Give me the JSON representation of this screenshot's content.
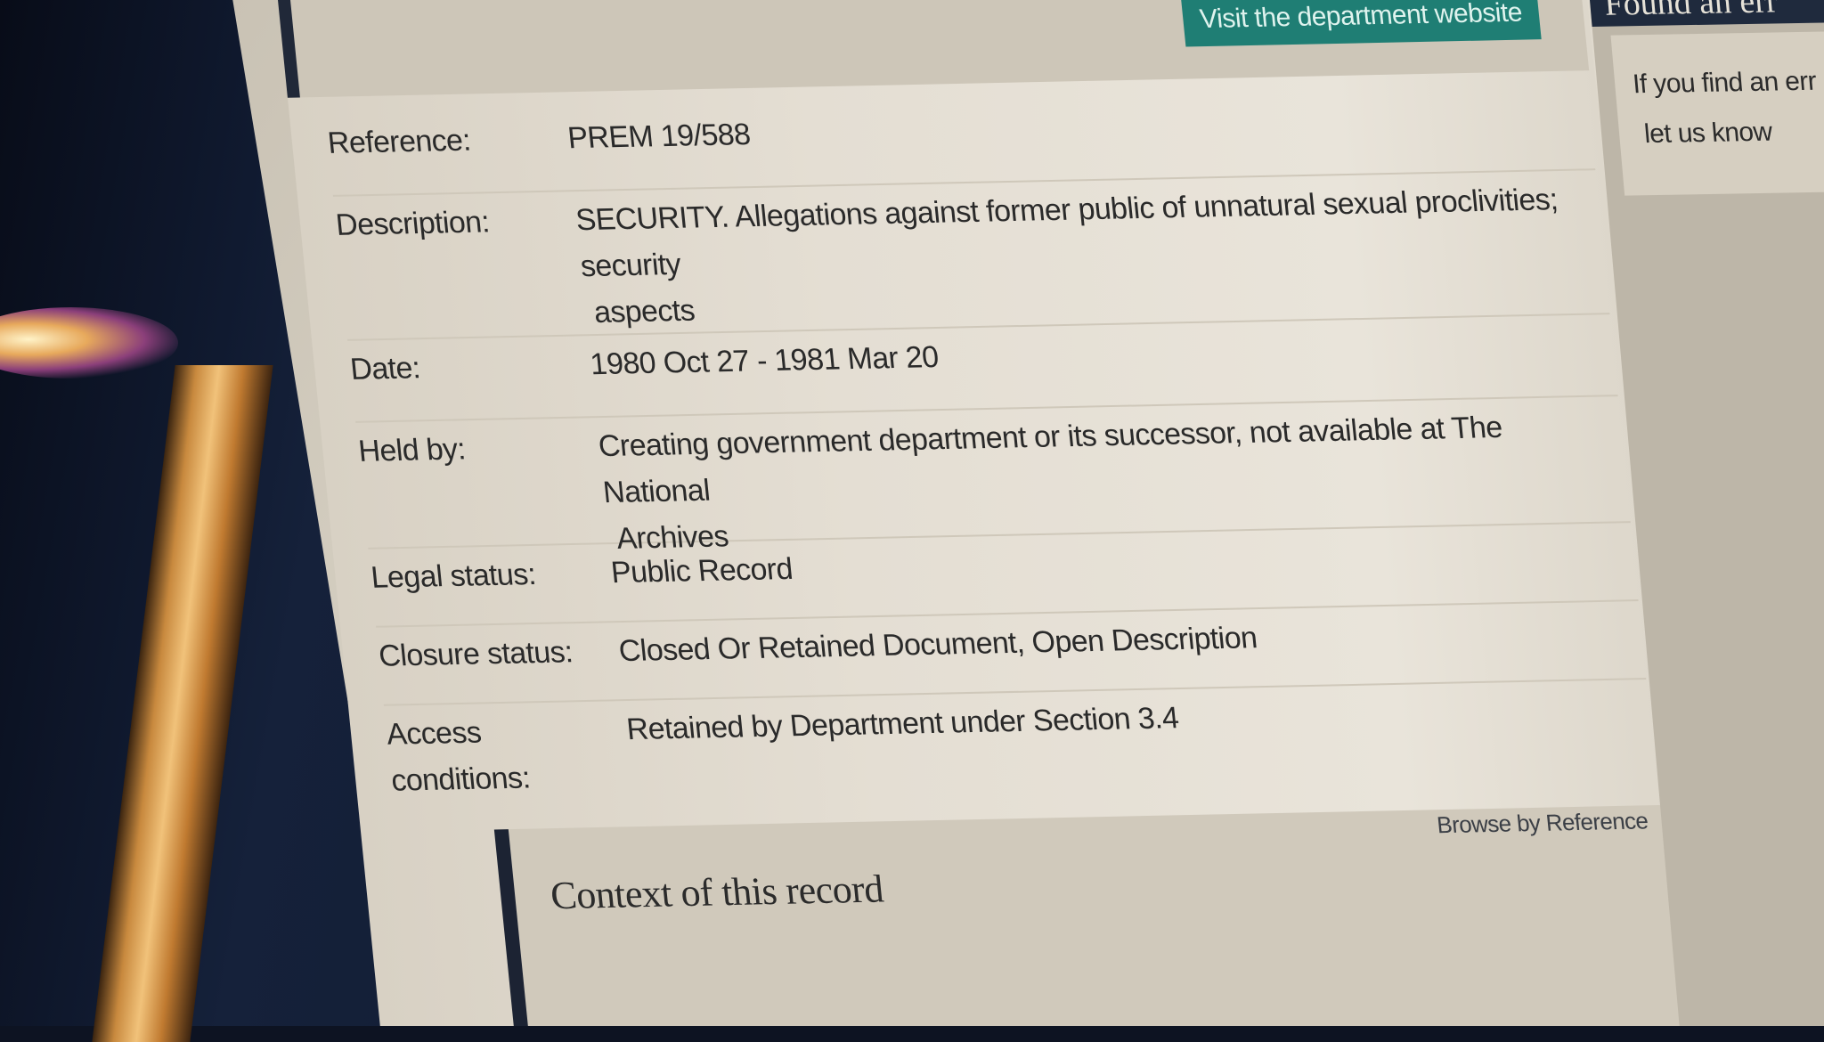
{
  "header": {
    "department_button": "Visit the department website"
  },
  "record": {
    "reference_label": "Reference:",
    "reference_value": "PREM 19/588",
    "description_label": "Description:",
    "description_value_line1": "SECURITY. Allegations against former public of unnatural sexual proclivities; security",
    "description_value_line2": "aspects",
    "date_label": "Date:",
    "date_value": "1980 Oct 27 - 1981 Mar 20",
    "held_by_label": "Held by:",
    "held_by_value_line1": "Creating government department or its successor, not available at The National",
    "held_by_value_line2": "Archives",
    "legal_status_label": "Legal status:",
    "legal_status_value": "Public Record",
    "closure_status_label": "Closure status:",
    "closure_status_value": "Closed Or Retained Document, Open Description",
    "access_label_line1": "Access",
    "access_label_line2": "conditions:",
    "access_value": "Retained by Department under Section 3.4"
  },
  "context": {
    "browse_link": "Browse by Reference",
    "title": "Context of this record"
  },
  "sidebar": {
    "tab_title": "Found an err",
    "card_line1": "If you find an err",
    "card_line2": "let us know"
  }
}
